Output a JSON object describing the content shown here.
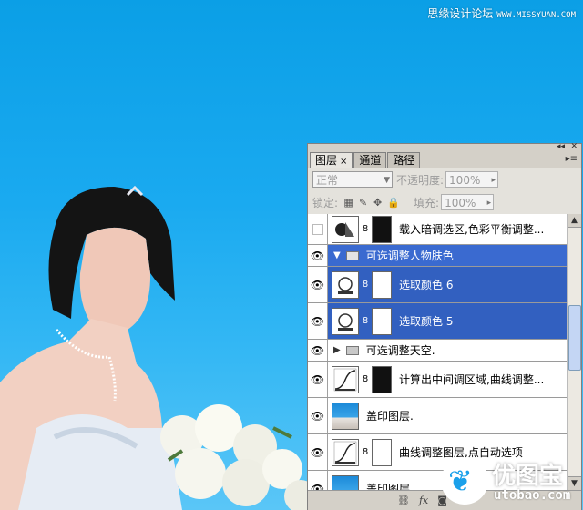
{
  "watermark": {
    "text": "思缘设计论坛",
    "site": "WWW.MISSYUAN.COM"
  },
  "panel": {
    "tabs": [
      {
        "label": "图层",
        "close": "×"
      },
      {
        "label": "通道"
      },
      {
        "label": "路径"
      }
    ],
    "blend_mode": "正常",
    "opacity_label": "不透明度:",
    "opacity_value": "100%",
    "lock_label": "锁定:",
    "fill_label": "填充:",
    "fill_value": "100%",
    "layers": [
      {
        "name": "载入暗调选区,色彩平衡调整...",
        "visible": false
      },
      {
        "name": "可选调整人物肤色",
        "visible": true,
        "group": true,
        "expanded": true
      },
      {
        "name": "选取颜色 6",
        "visible": true
      },
      {
        "name": "选取颜色 5",
        "visible": true
      },
      {
        "name": "可选调整天空.",
        "visible": true,
        "group": true,
        "expanded": false
      },
      {
        "name": "计算出中间调区域,曲线调整...",
        "visible": true
      },
      {
        "name": "盖印图层.",
        "visible": true
      },
      {
        "name": "曲线调整图层,点自动选项",
        "visible": true
      },
      {
        "name": "盖印图层",
        "visible": true
      }
    ]
  },
  "logo": {
    "cn": "优图宝",
    "en": "utobao.com"
  },
  "colors": {
    "selection": "#3260c0",
    "sky": "#1aaaf0"
  }
}
